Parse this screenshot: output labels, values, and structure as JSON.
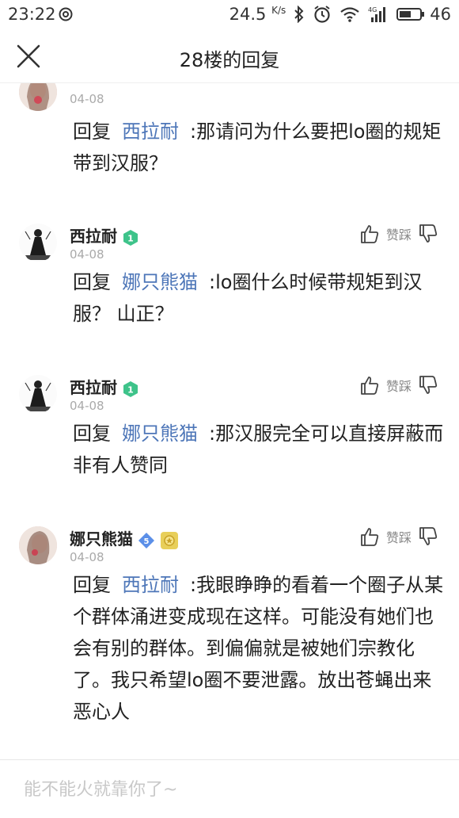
{
  "status_bar": {
    "time": "23:22",
    "net_speed": "24.5",
    "net_unit": "K/s",
    "battery": "46",
    "icons": [
      "netease-icon",
      "bluetooth-icon",
      "alarm-icon",
      "wifi-icon",
      "signal-4g-icon",
      "battery-icon"
    ]
  },
  "header": {
    "title": "28楼的回复",
    "close_icon": "close-icon"
  },
  "colors": {
    "mention": "#4d76b8",
    "badge_green": "#3ec38a",
    "badge_blue": "#5b8fe8",
    "date": "#aaaaaa"
  },
  "replies": [
    {
      "username": "",
      "date": "04-08",
      "reply_prefix": "回复",
      "mention": "西拉耐",
      "text": ":那请问为什么要把lo圈的规矩带到汉服？"
    },
    {
      "username": "西拉耐",
      "level": "1",
      "date": "04-08",
      "like_label": "赞",
      "dislike_label": "踩",
      "reply_prefix": "回复",
      "mention": "娜只熊猫",
      "text": ":lo圈什么时候带规矩到汉服？ 山正？"
    },
    {
      "username": "西拉耐",
      "level": "1",
      "date": "04-08",
      "like_label": "赞",
      "dislike_label": "踩",
      "reply_prefix": "回复",
      "mention": "娜只熊猫",
      "text": ":那汉服完全可以直接屏蔽而非有人赞同"
    },
    {
      "username": "娜只熊猫",
      "level": "5",
      "date": "04-08",
      "like_label": "赞",
      "dislike_label": "踩",
      "reply_prefix": "回复",
      "mention": "西拉耐",
      "text": ":我眼睁睁的看着一个圈子从某个群体涌进变成现在这样。可能没有她们也会有别的群体。到偏偏就是被她们宗教化了。我只希望lo圈不要泄露。放出苍蝇出来恶心人"
    }
  ],
  "input": {
    "placeholder": "能不能火就靠你了~",
    "value": ""
  }
}
